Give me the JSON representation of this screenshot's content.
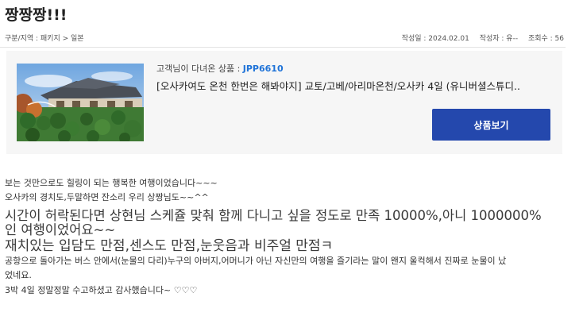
{
  "page": {
    "title": "짱짱짱!!!"
  },
  "meta": {
    "category_label": "구분/지역 : 패키지 > 일본",
    "date": "작성일 : 2024.02.01",
    "author": "작성자 : 유--",
    "views": "조회수 : 56"
  },
  "product": {
    "label": "고객님이 다녀온 상품 : ",
    "code": "JPP6610",
    "name": "[오사카여도 온천 한번은 해봐야지] 교토/고베/아리마온천/오사카 4일 (유니버셜스튜디..",
    "button_label": "상품보기",
    "accent": "#2448ad"
  },
  "review": {
    "lines": [
      "보는 것만으로도 힐링이 되는 행복한 여행이었습니다~~~",
      "오사카의 경치도,두말하면 잔소리 우리 상짱님도~~^^",
      "시간이 허락된다면 상현님 스케쥴 맞춰 함께 다니고 싶을 정도로 만족 10000%,아니 1000000%",
      "인 여행이었어요~~",
      "재치있는 입담도 만점,센스도 만점,눈웃음과 비주얼 만점ㅋ",
      "공항으로 돌아가는 버스 안에서(눈물의 다리)누구의 아버지,어머니가 아닌 자신만의 여행을 즐기라는 말이 왠지 울컥해서 진짜로 눈물이 났",
      "었네요.",
      "3박 4일 정말정말 수고하셨고 감사했습니다~ ♡♡♡"
    ]
  }
}
